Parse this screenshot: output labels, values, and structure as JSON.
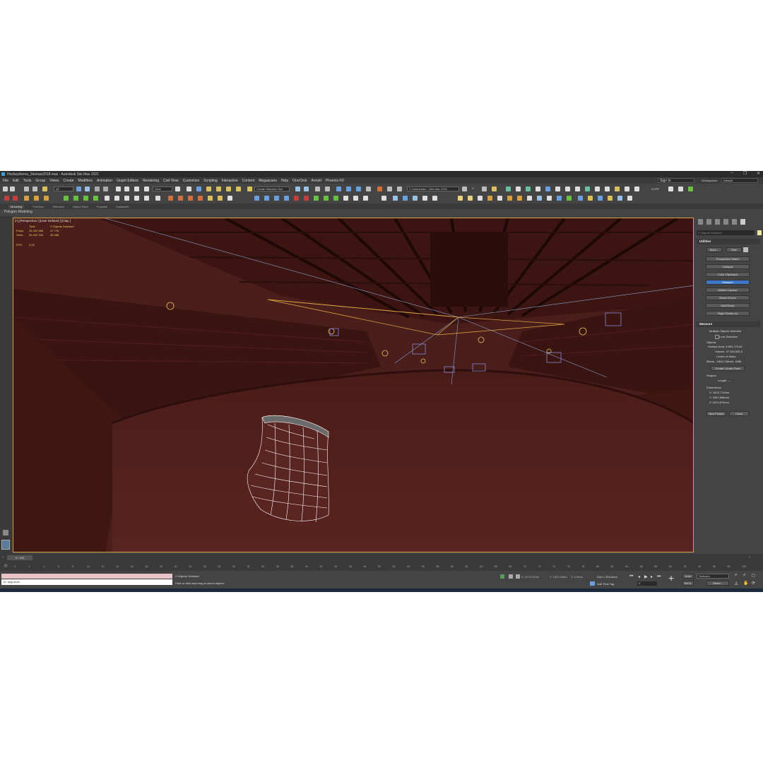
{
  "window": {
    "title": "HockeyArena_3dsmax2018.max - Autodesk 3ds Max 2021"
  },
  "menu": [
    "File",
    "Edit",
    "Tools",
    "Group",
    "Views",
    "Create",
    "Modifiers",
    "Animation",
    "Graph Editors",
    "Rendering",
    "Civil View",
    "Customize",
    "Scripting",
    "Interactive",
    "Content",
    "Megascans",
    "Help",
    "OneClick",
    "Arnold",
    "Phoenix FD"
  ],
  "signin": "Sign In",
  "workspace": {
    "label": "Workspaces:",
    "value": "Default"
  },
  "toolbar": {
    "filter": "All",
    "refcoord": "View",
    "selset": "Create Selection Set",
    "path": "C:\\Users\\adm...\\3ds Max 2021",
    "xopp": "XOPP"
  },
  "ribbon": {
    "tabs": [
      "Modeling",
      "Freeform",
      "Selection",
      "Object Paint",
      "Populate",
      "Datasmith"
    ],
    "sub": "Polygon Modeling"
  },
  "viewport": {
    "label": "[+] [Perspective ] [User Defined ] [Clay ]",
    "stats": {
      "total_label": "Total",
      "selected": "3 Objects Selected",
      "polys_label": "Polys:",
      "polys_total": "26 342 965",
      "polys_sel": "37 776",
      "verts_label": "Verts:",
      "verts_total": "26 402 332",
      "verts_sel": "38 966",
      "fps_label": "FPS:",
      "fps_value": "2,23"
    }
  },
  "command_panel": {
    "search": "3 Objects Selected",
    "utilities": {
      "title": "Utilities",
      "more": "More...",
      "sets": "Sets",
      "buttons": [
        "Perspective Match",
        "Collapse",
        "Color Clipboard",
        "Measure",
        "Motion Capture",
        "Reset XForm",
        "MAXScript",
        "Flight Studio (c)"
      ],
      "selected": "Measure"
    },
    "measure": {
      "title": "Measure",
      "multi": "Multiple Objects Selected",
      "lock": "Lock Selection",
      "objects": "Objects",
      "surface_area": "Surface Area:  6 805 275,82",
      "volume": "Volume:  47 283 835,3",
      "center_label": "Center of Mass:",
      "center_value": "98mm, -1826,748mm, 1896",
      "create_center": "Create Center Point",
      "shapes": "Shapes",
      "length": "Length:  ---",
      "dimensions": "Dimensions",
      "x": "X:  1523,712mm",
      "y": "Y:  3087,886mm",
      "z": "Z:  1674,874mm",
      "new_floater": "New Floater",
      "close": "Close"
    }
  },
  "timeline": {
    "slider": "0 / 100",
    "ticks": [
      "0",
      "2",
      "4",
      "6",
      "8",
      "10",
      "12",
      "14",
      "16",
      "18",
      "20",
      "22",
      "24",
      "26",
      "28",
      "30",
      "32",
      "34",
      "36",
      "38",
      "40",
      "42",
      "44",
      "46",
      "48",
      "50",
      "52",
      "54",
      "56",
      "58",
      "60",
      "62",
      "64",
      "66",
      "68",
      "70",
      "72",
      "74",
      "76",
      "78",
      "80",
      "82",
      "84",
      "86",
      "88",
      "90",
      "92",
      "94",
      "96",
      "98",
      "100"
    ]
  },
  "status": {
    "listener": "In: Ispp-level",
    "selected": "3 Objects Selected",
    "prompt": "Click or click-and-drag to select objects",
    "x": "X: 2074,370m",
    "y": "Y: 1327,548m",
    "z": "Z: 0,0mm",
    "grid": "Grid = 254,0mm",
    "addtimetag": "Add Time Tag",
    "auto": "Auto",
    "setk": "Set K.",
    "selected_dd": "Selected",
    "filters": "Filters...",
    "frame": "0"
  },
  "colors": {
    "viewport_bg": "#5a2420",
    "accent_blue": "#3b78c8",
    "stats_yellow": "#e8d060",
    "active_border": "#d8a040"
  }
}
